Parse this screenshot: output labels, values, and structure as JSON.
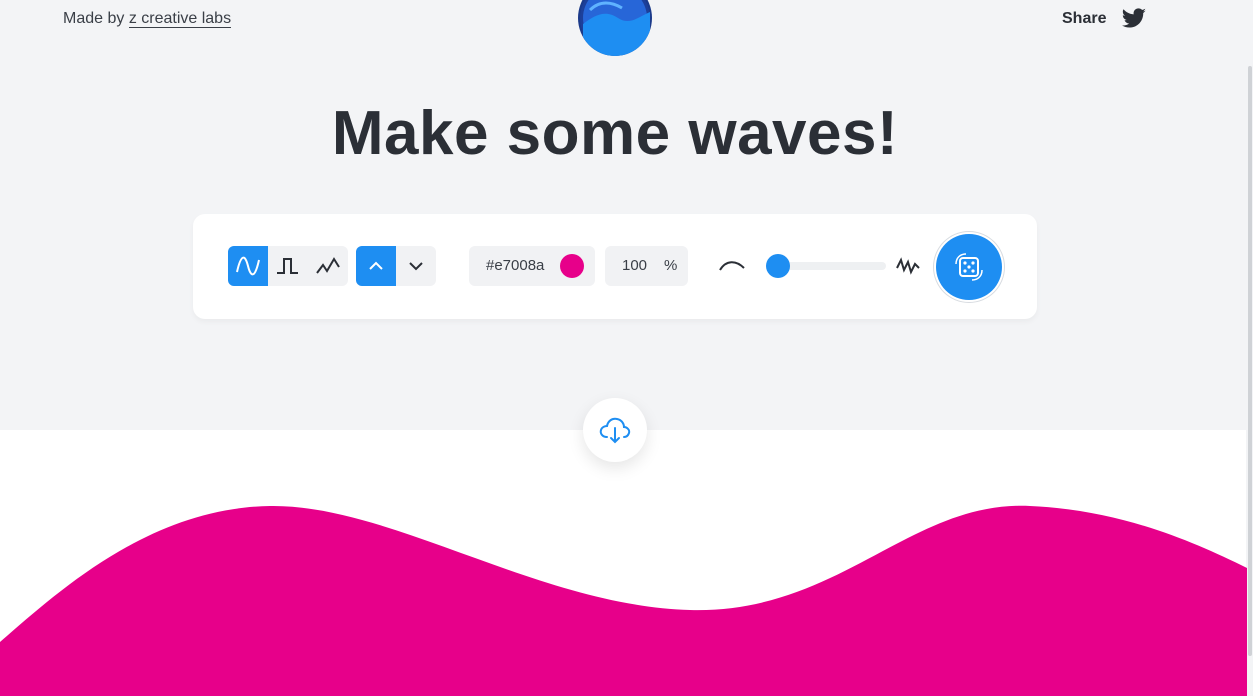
{
  "header": {
    "made_by_prefix": "Made by ",
    "made_by_link": "z creative labs",
    "share_label": "Share"
  },
  "hero": {
    "title": "Make some waves!"
  },
  "controls": {
    "wave_types": [
      "sine-wave-icon",
      "square-wave-icon",
      "triangle-wave-icon"
    ],
    "active_wave_type": "sine",
    "directions": [
      "chevron-up-icon",
      "chevron-down-icon"
    ],
    "active_direction": "up",
    "color": {
      "hex_text": "#e7008a",
      "swatch": "#e7008a"
    },
    "opacity": {
      "value": "100",
      "unit": "%"
    },
    "complexity_slider": {
      "value_fraction": 0.1
    }
  },
  "colors": {
    "accent": "#1e8ef2",
    "wave": "#e7008a",
    "background_top": "#f3f4f6",
    "text": "#2b2f36"
  }
}
